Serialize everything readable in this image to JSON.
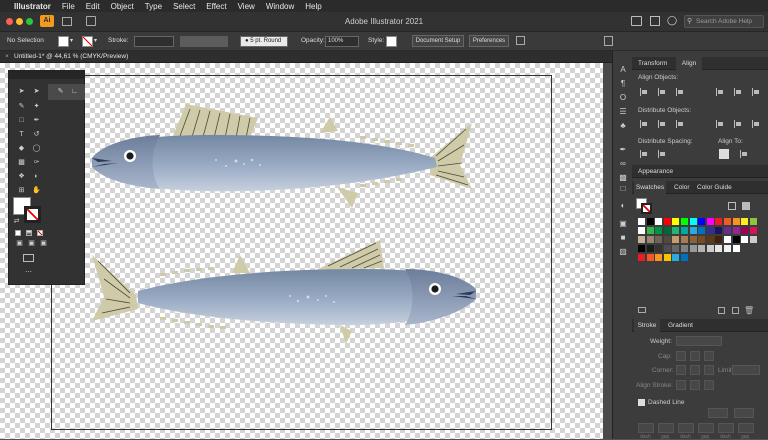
{
  "menubar": {
    "app": "Illustrator",
    "items": [
      "File",
      "Edit",
      "Object",
      "Type",
      "Select",
      "Effect",
      "View",
      "Window",
      "Help"
    ]
  },
  "window": {
    "title": "Adobe Illustrator 2021",
    "search_placeholder": "Search Adobe Help"
  },
  "control": {
    "selection": "No Selection",
    "stroke_label": "Stroke:",
    "brush": "5 pt. Round",
    "opacity_label": "Opacity:",
    "opacity": "100%",
    "style_label": "Style:",
    "doc_setup": "Document Setup",
    "preferences": "Preferences"
  },
  "document": {
    "tab_title": "Untitled-1* @ 44,61 % (CMYK/Preview)"
  },
  "panels": {
    "transform_tab": "Transform",
    "align_tab": "Align",
    "align_objects": "Align Objects:",
    "distribute_objects": "Distribute Objects:",
    "distribute_spacing": "Distribute Spacing:",
    "align_to": "Align To:",
    "appearance_tab": "Appearance",
    "swatches_tab": "Swatches",
    "color_tab": "Color",
    "color_guide_tab": "Color Guide",
    "stroke_tab": "Stroke",
    "gradient_tab": "Gradient",
    "weight_label": "Weight:",
    "cap_label": "Cap:",
    "corner_label": "Corner:",
    "limit_label": "Limit:",
    "align_stroke_label": "Align Stroke:",
    "dashed_line_label": "Dashed Line",
    "dash_labels": [
      "dash",
      "gap",
      "dash",
      "gap",
      "dash",
      "gap"
    ]
  },
  "swatch_rows": [
    [
      "#ffffff",
      "#000000",
      "#ffffff",
      "#ff0000",
      "#ffff00",
      "#00ff00",
      "#00ffff",
      "#0000ff",
      "#ff00ff",
      "#ed1c24",
      "#f15a24",
      "#f7931e",
      "#fcee21",
      "#8cc63f"
    ],
    [
      "#ffffff",
      "#39b54a",
      "#009245",
      "#006837",
      "#22b573",
      "#00a99d",
      "#29abe2",
      "#0071bc",
      "#2e3192",
      "#1b1464",
      "#662d91",
      "#93278f",
      "#9e005d",
      "#d4145a"
    ],
    [
      "#c7b299",
      "#998675",
      "#736357",
      "#534741",
      "#c69c6d",
      "#a67c52",
      "#8c6239",
      "#754c24",
      "#603813",
      "#42210b",
      "#ffffff",
      "#000000",
      "#ffffff",
      "#cccccc"
    ],
    [
      "#000000",
      "#1a1a1a",
      "#333333",
      "#4d4d4d",
      "#666666",
      "#808080",
      "#999999",
      "#b3b3b3",
      "#cccccc",
      "#e6e6e6",
      "#f2f2f2",
      "#ffffff"
    ],
    [
      "#ed1c24",
      "#f15a24",
      "#f7931e",
      "#f6c400",
      "#29abe2",
      "#0071bc"
    ]
  ],
  "icons": {
    "search": "search-icon",
    "bulb": "lightbulb-icon"
  }
}
